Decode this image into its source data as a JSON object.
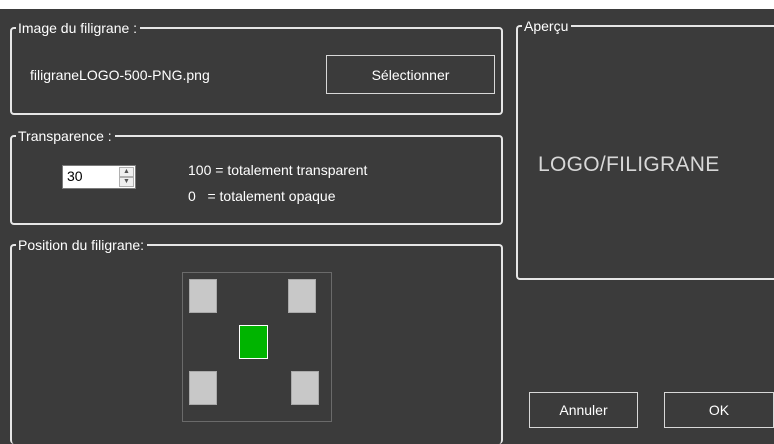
{
  "watermark_image": {
    "title": "Image du filigrane :",
    "filename": "filigraneLOGO-500-PNG.png",
    "select_label": "Sélectionner"
  },
  "transparency": {
    "title": "Transparence :",
    "value": "30",
    "up_glyph": "▲",
    "down_glyph": "▼",
    "help_line1": "100 = totalement transparent",
    "help_line2": "0   = totalement opaque"
  },
  "position": {
    "title": "Position du filigrane:",
    "selected": "center",
    "options": [
      "top-left",
      "top-right",
      "center",
      "bottom-left",
      "bottom-right"
    ]
  },
  "preview": {
    "title": "Aperçu",
    "text": "LOGO/FILIGRANE"
  },
  "buttons": {
    "cancel_label": "Annuler",
    "ok_label": "OK"
  },
  "colors": {
    "background": "#3b3b3b",
    "selected_cell": "#00b400",
    "unselected_cell": "#c8c8c8"
  }
}
